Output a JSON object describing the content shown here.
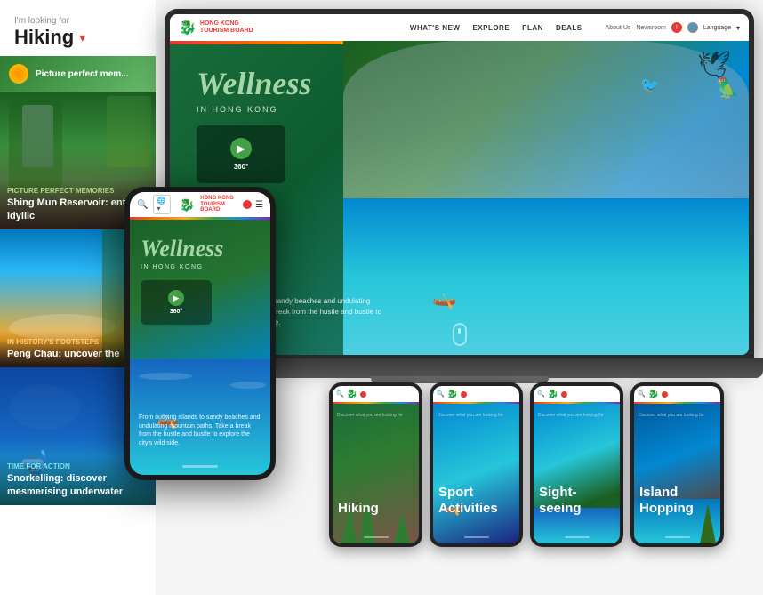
{
  "sidebar": {
    "looking_for_label": "I'm looking for",
    "category": "Hiking",
    "chevron": "▾",
    "banner_text": "Picture perfect mem...",
    "cards": [
      {
        "tag": "Picture perfect memories",
        "tag_color": "green",
        "title": "Shing Mun Reservoir: enter idyllic",
        "bg_class": "card-waterfall"
      },
      {
        "tag": "In history's footsteps",
        "tag_color": "orange",
        "title": "Peng Chau: uncover the",
        "bg_class": "card-beach"
      },
      {
        "tag": "Time for action",
        "tag_color": "cyan",
        "title": "Snorkelling: discover mesmerising underwater",
        "bg_class": "card-underwater"
      }
    ]
  },
  "laptop": {
    "nav": {
      "what_new": "WHAT'S NEW",
      "explore": "EXPLORE",
      "plan": "PLAN",
      "deals": "DEALS",
      "about": "About Us",
      "newsroom": "Newsroom",
      "language": "Language"
    },
    "hero": {
      "wellness_title": "Wellness",
      "subtitle": "IN HONG KONG",
      "description": "From outlying islands to sandy beaches and undulating mountain paths. Take a break from the hustle and bustle to explore the city's wild side.",
      "play_label": "360°"
    }
  },
  "phone": {
    "hero": {
      "wellness_title": "Wellness",
      "subtitle": "IN HONG KONG",
      "description": "From outlying islands to sandy beaches and undulating mountain paths. Take a break from the hustle and bustle to explore the city's wild side.",
      "play_label": "360°"
    }
  },
  "bottom_cards": [
    {
      "id": "hiking",
      "title": "Hiking",
      "tag": "Discover what you are looking for"
    },
    {
      "id": "sport-activities",
      "title": "Sport Activities",
      "tag": "Discover what you are looking for"
    },
    {
      "id": "sightseeing",
      "title": "Sight-seeing",
      "tag": "Discover what you are looking for"
    },
    {
      "id": "island-hopping",
      "title": "Island Hopping",
      "tag": "Discover what you are looking for"
    }
  ]
}
